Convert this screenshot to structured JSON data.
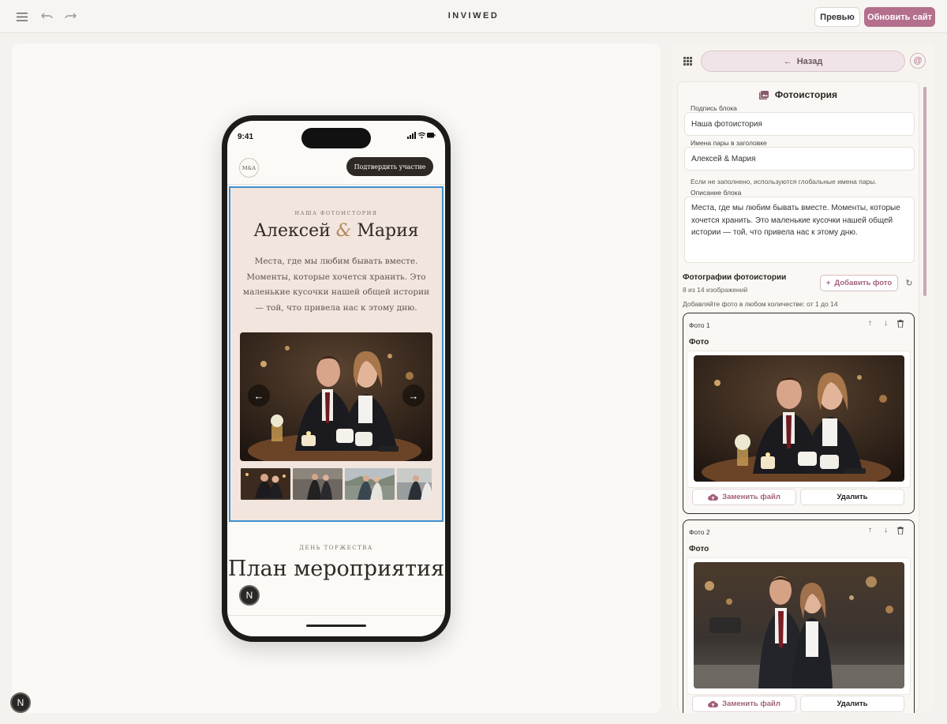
{
  "topbar": {
    "brand": "INVIWED",
    "preview_label": "Превью",
    "update_label": "Обновить сайт",
    "icons": [
      "menu-icon",
      "undo-icon",
      "redo-icon"
    ]
  },
  "phone": {
    "time": "9:41",
    "monogram": "M&A",
    "rsvp_label": "Подтвердить участие",
    "story": {
      "caption": "НАША ФОТОИСТОРИЯ",
      "name1": "Алексей",
      "amp": "&",
      "name2": "Мария",
      "description": "Места, где мы любим бывать вместе. Моменты, которые хочется хранить. Это маленькие кусочки нашей общей истории — той, что привела нас к этому дню."
    },
    "event": {
      "caption": "ДЕНЬ ТОРЖЕСТВА",
      "title": "План мероприятия"
    },
    "badge": "N"
  },
  "corner_badge": "N",
  "panel": {
    "back_label": "Назад",
    "block_title": "Фотоистория",
    "caption_label": "Подпись блока",
    "caption_value": "Наша фотоистория",
    "names_label": "Имена пары в заголовке",
    "names_value": "Алексей & Мария",
    "names_hint": "Если не заполнено, используются глобальные имена пары.",
    "desc_label": "Описание блока",
    "desc_value": "Места, где мы любим бывать вместе. Моменты, которые хочется хранить. Это маленькие кусочки нашей общей истории — той, что привела нас к этому дню.",
    "photos_title": "Фотографии фотоистории",
    "photos_count": "8 из 14 изображений",
    "add_photo_label": "Добавить фото",
    "photos_hint": "Добавляйте фото в любом количестве: от 1 до 14",
    "photos": [
      {
        "title": "Фото 1",
        "label": "Фото",
        "replace": "Заменить файл",
        "delete": "Удалить"
      },
      {
        "title": "Фото 2",
        "label": "Фото",
        "replace": "Заменить файл",
        "delete": "Удалить"
      }
    ]
  },
  "colors": {
    "accent": "#b46f8c",
    "selection": "#3f8fcf",
    "story_bg": "#f1e5dd"
  }
}
